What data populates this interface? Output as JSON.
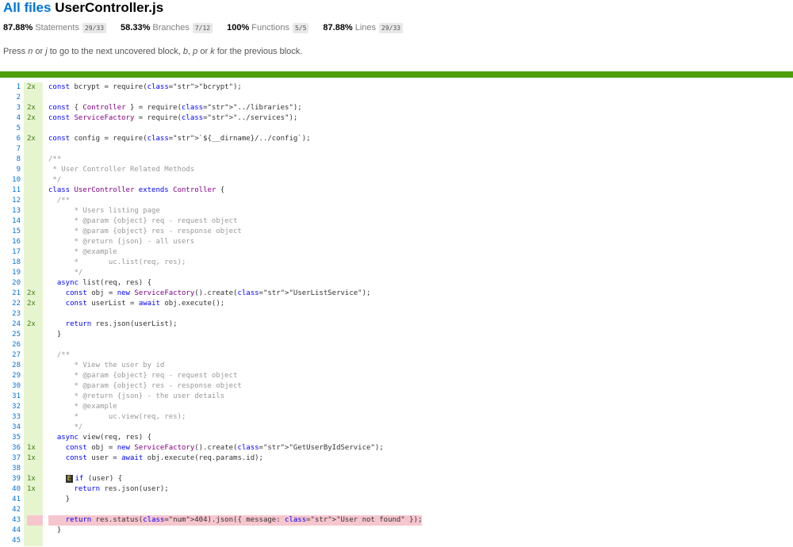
{
  "header": {
    "all_files": "All files",
    "file_name": "UserController.js"
  },
  "metrics": [
    {
      "pct": "87.88%",
      "label": "Statements",
      "fraction": "29/33"
    },
    {
      "pct": "58.33%",
      "label": "Branches",
      "fraction": "7/12"
    },
    {
      "pct": "100%",
      "label": "Functions",
      "fraction": "5/5"
    },
    {
      "pct": "87.88%",
      "label": "Lines",
      "fraction": "29/33"
    }
  ],
  "help": {
    "p1": "Press ",
    "k1": "n",
    "p2": " or ",
    "k2": "j",
    "p3": " to go to the next uncovered block, ",
    "k3": "b",
    "p4": ", ",
    "k4": "p",
    "p5": " or ",
    "k5": "k",
    "p6": " for the previous block."
  },
  "colors": {
    "status_bar": "#4d9f0c",
    "covered": "#e6f5d0",
    "uncovered": "#f6c6ce",
    "link": "#0074d9"
  },
  "badge_label": "E",
  "lines": [
    {
      "n": "1",
      "count": "2x",
      "code": "const bcrypt = require(\"bcrypt\");"
    },
    {
      "n": "2",
      "count": "",
      "code": ""
    },
    {
      "n": "3",
      "count": "2x",
      "code": "const { Controller } = require(\"../libraries\");"
    },
    {
      "n": "4",
      "count": "2x",
      "code": "const ServiceFactory = require(\"../services\");"
    },
    {
      "n": "5",
      "count": "",
      "code": ""
    },
    {
      "n": "6",
      "count": "2x",
      "code": "const config = require(`${__dirname}/../config`);"
    },
    {
      "n": "7",
      "count": "",
      "code": ""
    },
    {
      "n": "8",
      "count": "",
      "code": "/**"
    },
    {
      "n": "9",
      "count": "",
      "code": " * User Controller Related Methods"
    },
    {
      "n": "10",
      "count": "",
      "code": " */"
    },
    {
      "n": "11",
      "count": "",
      "code": "class UserController extends Controller {"
    },
    {
      "n": "12",
      "count": "",
      "code": "  /**"
    },
    {
      "n": "13",
      "count": "",
      "code": "      * Users listing page"
    },
    {
      "n": "14",
      "count": "",
      "code": "      * @param {object} req - request object"
    },
    {
      "n": "15",
      "count": "",
      "code": "      * @param {object} res - response object"
    },
    {
      "n": "16",
      "count": "",
      "code": "      * @return {json} - all users"
    },
    {
      "n": "17",
      "count": "",
      "code": "      * @example"
    },
    {
      "n": "18",
      "count": "",
      "code": "      *       uc.list(req, res);"
    },
    {
      "n": "19",
      "count": "",
      "code": "      */"
    },
    {
      "n": "20",
      "count": "",
      "code": "  async list(req, res) {"
    },
    {
      "n": "21",
      "count": "2x",
      "code": "    const obj = new ServiceFactory().create(\"UserListService\");"
    },
    {
      "n": "22",
      "count": "2x",
      "code": "    const userList = await obj.execute();"
    },
    {
      "n": "23",
      "count": "",
      "code": ""
    },
    {
      "n": "24",
      "count": "2x",
      "code": "    return res.json(userList);"
    },
    {
      "n": "25",
      "count": "",
      "code": "  }"
    },
    {
      "n": "26",
      "count": "",
      "code": ""
    },
    {
      "n": "27",
      "count": "",
      "code": "  /**"
    },
    {
      "n": "28",
      "count": "",
      "code": "      * View the user by id"
    },
    {
      "n": "29",
      "count": "",
      "code": "      * @param {object} req - request object"
    },
    {
      "n": "30",
      "count": "",
      "code": "      * @param {object} res - response object"
    },
    {
      "n": "31",
      "count": "",
      "code": "      * @return {json} - the user details"
    },
    {
      "n": "32",
      "count": "",
      "code": "      * @example"
    },
    {
      "n": "33",
      "count": "",
      "code": "      *       uc.view(req, res);"
    },
    {
      "n": "34",
      "count": "",
      "code": "      */"
    },
    {
      "n": "35",
      "count": "",
      "code": "  async view(req, res) {"
    },
    {
      "n": "36",
      "count": "1x",
      "code": "    const obj = new ServiceFactory().create(\"GetUserByIdService\");"
    },
    {
      "n": "37",
      "count": "1x",
      "code": "    const user = await obj.execute(req.params.id);"
    },
    {
      "n": "38",
      "count": "",
      "code": ""
    },
    {
      "n": "39",
      "count": "1x",
      "code": "if (user) {",
      "badge": true
    },
    {
      "n": "40",
      "count": "1x",
      "code": "      return res.json(user);"
    },
    {
      "n": "41",
      "count": "",
      "code": "    }"
    },
    {
      "n": "42",
      "count": "",
      "code": ""
    },
    {
      "n": "43",
      "count": "",
      "code": "    return res.status(404).json({ message: \"User not found\" });",
      "miss": true
    },
    {
      "n": "44",
      "count": "",
      "code": "  }"
    },
    {
      "n": "45",
      "count": "",
      "code": ""
    }
  ]
}
